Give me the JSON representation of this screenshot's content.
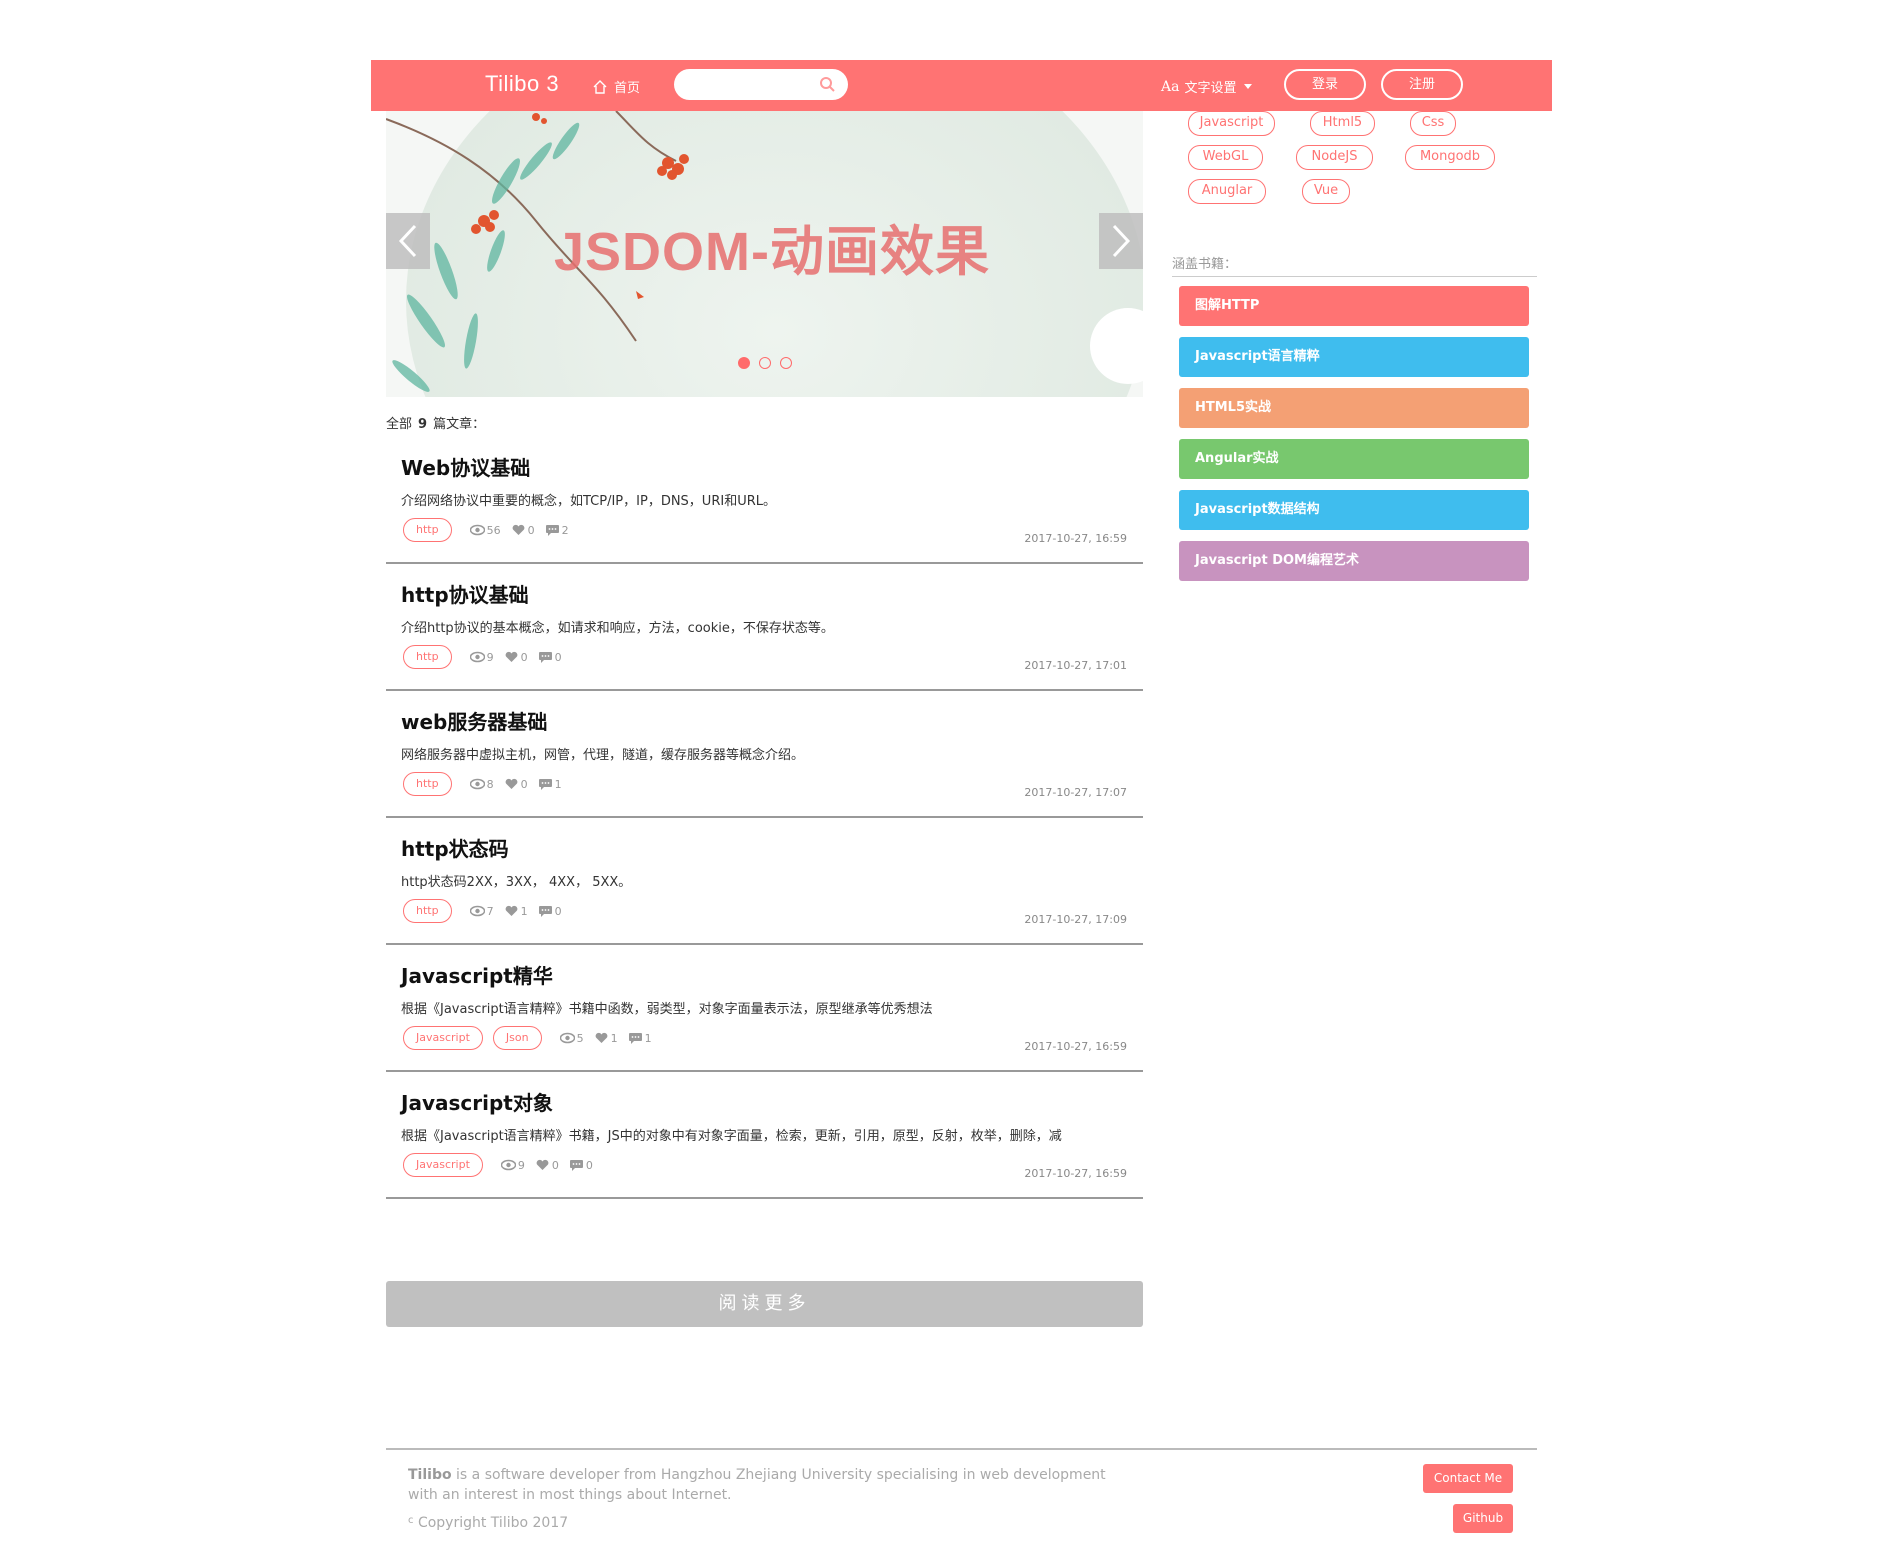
{
  "header": {
    "brand": "Tilibo 3",
    "home": "首页",
    "search_placeholder": "",
    "font_setting_icon": "Aa",
    "font_setting": "文字设置",
    "login": "登录",
    "register": "注册"
  },
  "banner": {
    "title": "JSDOM-动画效果",
    "slides": 3,
    "active_slide": 1
  },
  "list": {
    "count_prefix": "全部",
    "count": "9",
    "count_suffix": "篇文章："
  },
  "articles": [
    {
      "title": "Web协议基础",
      "summary": "介绍网络协议中重要的概念，如TCP/IP，IP，DNS，URI和URL。",
      "tags": [
        "http"
      ],
      "views": "56",
      "likes": "0",
      "comments": "2",
      "date": "2017-10-27, 16:59"
    },
    {
      "title": "http协议基础",
      "summary": "介绍http协议的基本概念，如请求和响应，方法，cookie，不保存状态等。",
      "tags": [
        "http"
      ],
      "views": "9",
      "likes": "0",
      "comments": "0",
      "date": "2017-10-27, 17:01"
    },
    {
      "title": "web服务器基础",
      "summary": "网络服务器中虚拟主机，网管，代理，隧道，缓存服务器等概念介绍。",
      "tags": [
        "http"
      ],
      "views": "8",
      "likes": "0",
      "comments": "1",
      "date": "2017-10-27, 17:07"
    },
    {
      "title": "http状态码",
      "summary": "http状态码2XX，3XX， 4XX， 5XX。",
      "tags": [
        "http"
      ],
      "views": "7",
      "likes": "1",
      "comments": "0",
      "date": "2017-10-27, 17:09"
    },
    {
      "title": "Javascript精华",
      "summary": "根据《Javascript语言精粹》书籍中函数，弱类型，对象字面量表示法，原型继承等优秀想法",
      "tags": [
        "Javascript",
        "Json"
      ],
      "views": "5",
      "likes": "1",
      "comments": "1",
      "date": "2017-10-27, 16:59"
    },
    {
      "title": "Javascript对象",
      "summary": "根据《Javascript语言精粹》书籍，JS中的对象中有对象字面量，检索，更新，引用，原型，反射，枚举，删除，减",
      "tags": [
        "Javascript"
      ],
      "views": "9",
      "likes": "0",
      "comments": "0",
      "date": "2017-10-27, 16:59"
    }
  ],
  "read_more": "阅读更多",
  "sidebar": {
    "tags": [
      "Javascript",
      "Html5",
      "Css",
      "WebGL",
      "NodeJS",
      "Mongodb",
      "Anuglar",
      "Vue"
    ],
    "books_label": "涵盖书籍：",
    "books": [
      {
        "label": "图解HTTP",
        "color": "#ff7373"
      },
      {
        "label": "Javascript语言精粹",
        "color": "#3fbdee"
      },
      {
        "label": "HTML5实战",
        "color": "#f4a074"
      },
      {
        "label": "Angular实战",
        "color": "#78c86e"
      },
      {
        "label": "Javascript数据结构",
        "color": "#3fbdee"
      },
      {
        "label": "Javascript DOM编程艺术",
        "color": "#c893bf"
      }
    ]
  },
  "footer": {
    "brand": "Tilibo",
    "description": " is a software developer from Hangzhou Zhejiang University specialising in web development with an interest in most things about Internet.",
    "copyright_symbol": "c",
    "copyright": "Copyright Tilibo 2017",
    "contact": "Contact Me",
    "github": "Github"
  },
  "colors": {
    "accent": "#ff7373",
    "read_more_bg": "#c0c0c0"
  }
}
